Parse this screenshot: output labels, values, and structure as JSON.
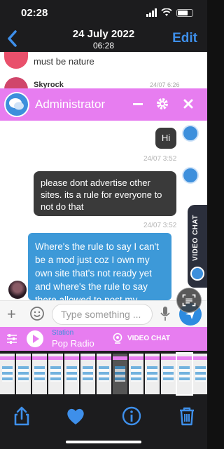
{
  "status": {
    "time": "02:28"
  },
  "photos_header": {
    "back_label": "",
    "date": "24 July 2022",
    "time": "06:28",
    "edit_label": "Edit"
  },
  "previous_messages": [
    {
      "text": "must be nature"
    },
    {
      "name": "Skyrock",
      "time": "24/07 6:26"
    }
  ],
  "chat": {
    "title": "Administrator",
    "messages": [
      {
        "side": "right",
        "text": "Hi",
        "time": "24/07 3:52"
      },
      {
        "side": "right",
        "text": "please dont advertise other sites. its a rule for everyone to not do that",
        "time": "24/07 3:52"
      },
      {
        "side": "left",
        "text": "Where's the rule to say I can't be a mod just coz I own my own site that's not ready yet and where's the rule to say there allowed to post my personal"
      }
    ],
    "video_chat_label": "VIDEO CHAT",
    "input_placeholder": "Type something ..."
  },
  "radio": {
    "station_label": "Station",
    "station_name": "Pop Radio",
    "video_chat_label": "VIDEO CHAT"
  },
  "colors": {
    "accent": "#e77df0",
    "blue": "#3d99d8",
    "ios_blue": "#3e8fea"
  }
}
